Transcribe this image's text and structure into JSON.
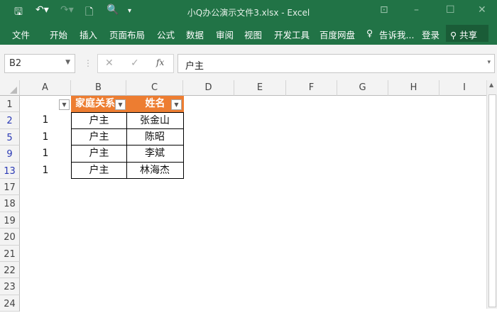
{
  "title": "小Q办公演示文件3.xlsx - Excel",
  "ribbon": {
    "tabs": [
      "文件",
      "开始",
      "插入",
      "页面布局",
      "公式",
      "数据",
      "审阅",
      "视图",
      "开发工具",
      "百度网盘"
    ],
    "tell_me": "告诉我...",
    "login": "登录",
    "share": "共享"
  },
  "namebox": "B2",
  "formula": "户主",
  "fx": "fx",
  "columns": [
    "A",
    "B",
    "C",
    "D",
    "E",
    "F",
    "G",
    "H",
    "I"
  ],
  "rows": [
    "1",
    "2",
    "5",
    "9",
    "13",
    "17",
    "18",
    "19",
    "20",
    "21",
    "22",
    "23",
    "24"
  ],
  "table": {
    "headers": [
      "家庭关系",
      "姓名"
    ],
    "a_values": [
      "1",
      "1",
      "1",
      "1"
    ],
    "b_values": [
      "户主",
      "户主",
      "户主",
      "户主"
    ],
    "c_values": [
      "张金山",
      "陈昭",
      "李斌",
      "林海杰"
    ]
  }
}
